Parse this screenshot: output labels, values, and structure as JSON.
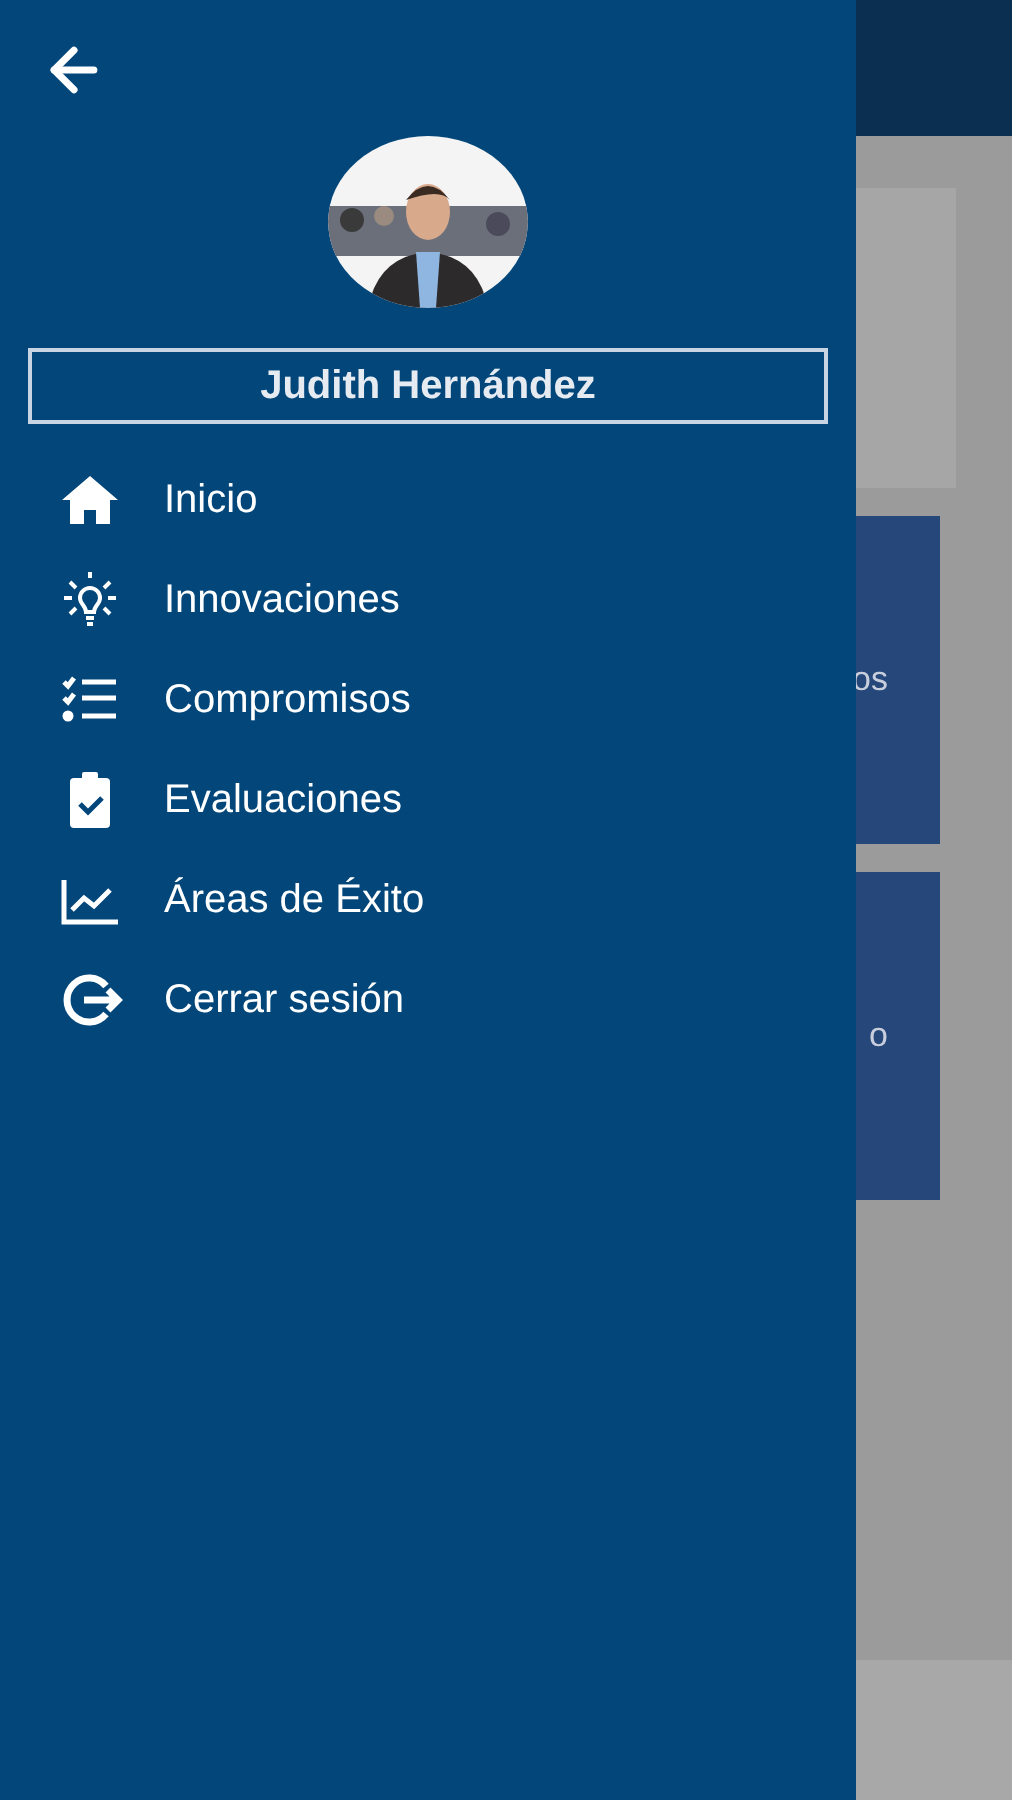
{
  "drawer": {
    "user_name": "Judith Hernández",
    "menu": [
      {
        "label": "Inicio"
      },
      {
        "label": "Innovaciones"
      },
      {
        "label": "Compromisos"
      },
      {
        "label": "Evaluaciones"
      },
      {
        "label": "Áreas de Éxito"
      },
      {
        "label": "Cerrar sesión"
      }
    ]
  },
  "background": {
    "cards": [
      {
        "label": "os"
      },
      {
        "label": "o"
      }
    ]
  }
}
